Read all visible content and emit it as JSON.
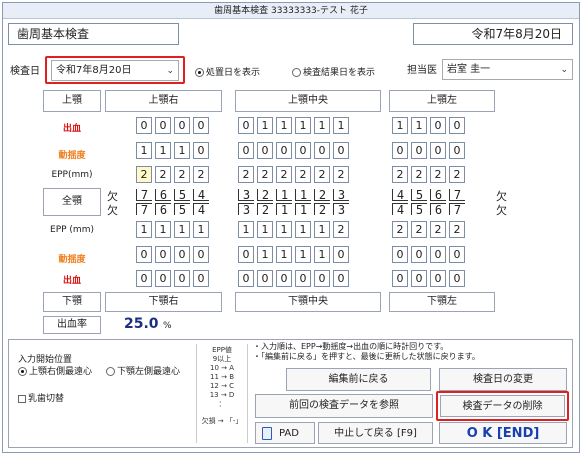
{
  "window_title": "歯周基本検査 33333333-テスト 花子",
  "header": {
    "title": "歯周基本検査",
    "date_display": "令和7年8月20日"
  },
  "exam_date": {
    "label": "検査日",
    "value": "令和7年8月20日"
  },
  "radios": {
    "show_treatment_day": "処置日を表示",
    "show_result_day": "検査結果日を表示"
  },
  "doctor": {
    "label": "担当医",
    "value": "岩室 圭一"
  },
  "upper_jaw": {
    "label": "上顎",
    "right": "上顎右",
    "center": "上顎中央",
    "left": "上顎左"
  },
  "lower_jaw": {
    "label": "下顎",
    "right": "下顎右",
    "center": "下顎中央",
    "left": "下顎左"
  },
  "row_labels": {
    "bleeding": "出血",
    "mobility": "動揺度",
    "epp_upper": "EPP(mm)",
    "full_jaw": "全顎",
    "epp_lower": "EPP (mm)"
  },
  "tooth_missing_mark": "欠",
  "grid": {
    "upper_bleeding": [
      "0",
      "0",
      "0",
      "0",
      "0",
      "1",
      "1",
      "1",
      "1",
      "1",
      "1",
      "1",
      "0",
      "0"
    ],
    "upper_mobility": [
      "1",
      "1",
      "1",
      "0",
      "0",
      "0",
      "0",
      "0",
      "0",
      "0",
      "0",
      "0",
      "0",
      "0"
    ],
    "upper_epp": [
      "2",
      "2",
      "2",
      "2",
      "2",
      "2",
      "2",
      "2",
      "2",
      "2",
      "2",
      "2",
      "2",
      "2"
    ],
    "upper_teeth": [
      "7",
      "6",
      "5",
      "4",
      "3",
      "2",
      "1",
      "1",
      "2",
      "3",
      "4",
      "5",
      "6",
      "7"
    ],
    "lower_teeth": [
      "7",
      "6",
      "5",
      "4",
      "3",
      "2",
      "1",
      "1",
      "2",
      "3",
      "4",
      "5",
      "6",
      "7"
    ],
    "lower_epp": [
      "1",
      "1",
      "1",
      "1",
      "1",
      "1",
      "1",
      "1",
      "1",
      "2",
      "2",
      "2",
      "2",
      "2"
    ],
    "lower_mobility": [
      "0",
      "0",
      "0",
      "0",
      "0",
      "1",
      "1",
      "1",
      "1",
      "0",
      "0",
      "0",
      "0",
      "0"
    ],
    "lower_bleeding": [
      "0",
      "0",
      "0",
      "0",
      "0",
      "0",
      "0",
      "0",
      "0",
      "0",
      "0",
      "0",
      "0",
      "0"
    ]
  },
  "bleeding_rate": {
    "label": "出血率",
    "value": "25.0",
    "unit": "%"
  },
  "input_start": {
    "label": "入力開始位置",
    "option1": "上顎右側最遠心",
    "option2": "下顎左側最遠心"
  },
  "milk_teeth": {
    "label": "乳歯切替"
  },
  "epp_legend": {
    "title": "EPP値",
    "l1": "9以上",
    "l2": "10 → A",
    "l3": "11 → B",
    "l4": "12 → C",
    "l5": "13 → D",
    "l6": "：",
    "missing": "欠損 → 「-」"
  },
  "notes": {
    "line1": "・入力順は、EPP→動揺度→出血の順に時計回りです。",
    "line2": "・「編集前に戻る」を押すと、最後に更新した状態に戻ります。"
  },
  "buttons": {
    "revert": "編集前に戻る",
    "change_date": "検査日の変更",
    "reference_prev": "前回の検査データを参照",
    "delete_data": "検査データの削除",
    "pad": "PAD",
    "cancel": "中止して戻る [F9]",
    "ok": "O K [END]"
  },
  "colors": {
    "highlight": "#e02020",
    "ok_text": "#1a3fb0",
    "bleeding": "#e01010",
    "mobility": "#f08020"
  }
}
